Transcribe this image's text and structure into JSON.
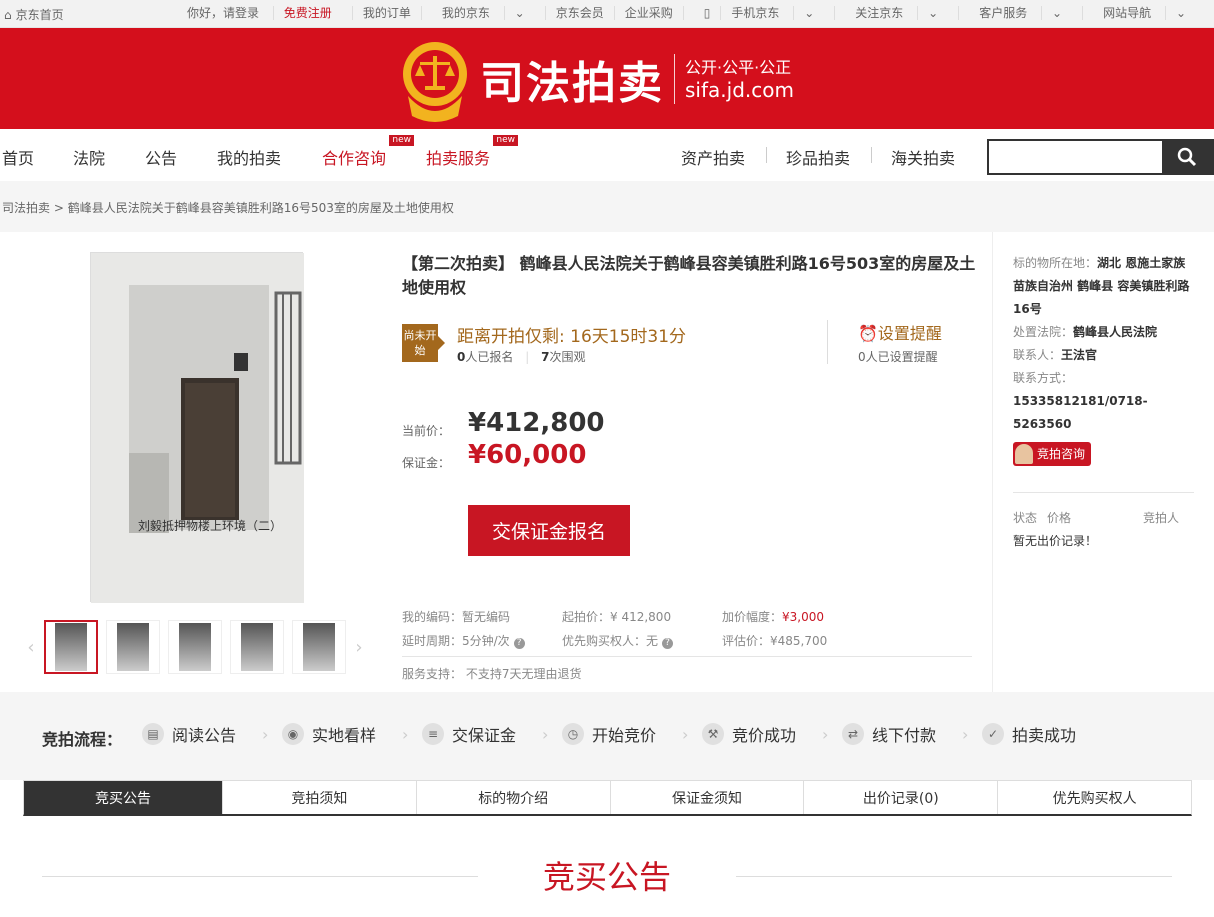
{
  "topbar": {
    "home": "京东首页",
    "greeting": "你好，请登录",
    "register": "免费注册",
    "links": [
      "我的订单",
      "我的京东",
      "京东会员",
      "企业采购",
      "手机京东",
      "关注京东",
      "客户服务",
      "网站导航"
    ]
  },
  "banner": {
    "title": "司法拍卖",
    "slogan": "公开·公平·公正",
    "url": "sifa.jd.com"
  },
  "nav": {
    "left": [
      "首页",
      "法院",
      "公告",
      "我的拍卖",
      "合作咨询",
      "拍卖服务"
    ],
    "new_badge": "new",
    "right": [
      "资产拍卖",
      "珍品拍卖",
      "海关拍卖"
    ]
  },
  "breadcrumb": {
    "root": "司法拍卖",
    "current": "鹤峰县人民法院关于鹤峰县容美镇胜利路16号503室的房屋及土地使用权"
  },
  "photo": {
    "caption": "刘毅抵押物楼上环境（二）"
  },
  "item": {
    "title": "【第二次拍卖】 鹤峰县人民法院关于鹤峰县容美镇胜利路16号503室的房屋及土地使用权",
    "status": "尚未开始",
    "remain": "距离开拍仅剩: 16天15时31分",
    "signups": "0",
    "signups_label": "人已报名",
    "views": "7",
    "views_label": "次围观",
    "reminder_label": "设置提醒",
    "reminder_count": "0人已设置提醒",
    "current_price_label": "当前价：",
    "current_price": "¥412,800",
    "deposit_label": "保证金：",
    "deposit": "¥60,000",
    "deposit_button": "交保证金报名",
    "details": {
      "code": "我的编码：暂无编码",
      "start": "起拍价：¥ 412,800",
      "increment_label": "加价幅度：",
      "increment": "¥3,000",
      "delay": "延时周期：5分钟/次",
      "priority": "优先购买权人：无",
      "appraisal": "评估价：¥485,700"
    },
    "service": "服务支持：  不支持7天无理由退货"
  },
  "side": {
    "location_label": "标的物所在地：",
    "location": "湖北 恩施土家族苗族自治州 鹤峰县 容美镇胜利路16号",
    "court_label": "处置法院：",
    "court": "鹤峰县人民法院",
    "contact_label": "联系人：",
    "contact": "王法官",
    "phone_label": "联系方式：",
    "phone": "15335812181/0718-5263560",
    "consult_button": "竞拍咨询",
    "bid_headers": [
      "状态",
      "价格",
      "竞拍人"
    ],
    "bid_empty": "暂无出价记录！"
  },
  "flow": {
    "label": "竞拍流程：",
    "steps": [
      "阅读公告",
      "实地看样",
      "交保证金",
      "开始竞价",
      "竞价成功",
      "线下付款",
      "拍卖成功"
    ]
  },
  "tabs": [
    "竞买公告",
    "竞拍须知",
    "标的物介绍",
    "保证金须知",
    "出价记录(0)",
    "优先购买权人"
  ],
  "announcement_title": "竞买公告",
  "colors": {
    "brand_red": "#d40f1c",
    "accent_red": "#c81623",
    "gold": "#a3681d"
  }
}
